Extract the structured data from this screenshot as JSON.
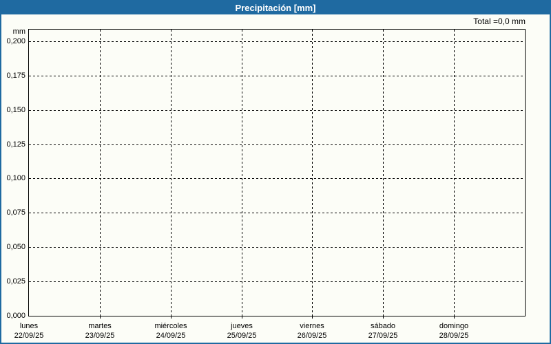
{
  "window": {
    "title": "Precipitación [mm]"
  },
  "colors": {
    "titlebar_bg": "#1f6aa1",
    "titlebar_text": "#ffffff",
    "frame_border": "#1f6aa1",
    "background": "#fcfdf7",
    "grid": "#000000",
    "text": "#000000"
  },
  "chart_data": {
    "type": "bar",
    "title": "Precipitación [mm]",
    "total_label": "Total =0,0 mm",
    "xlabel": "",
    "ylabel": "mm",
    "ylim": [
      0,
      0.2085
    ],
    "grid": true,
    "legend": false,
    "yticks": [
      {
        "value": 0.2,
        "label": "0,200"
      },
      {
        "value": 0.175,
        "label": "0,175"
      },
      {
        "value": 0.15,
        "label": "0,150"
      },
      {
        "value": 0.125,
        "label": "0,125"
      },
      {
        "value": 0.1,
        "label": "0,100"
      },
      {
        "value": 0.075,
        "label": "0,075"
      },
      {
        "value": 0.05,
        "label": "0,050"
      },
      {
        "value": 0.025,
        "label": "0,025"
      },
      {
        "value": 0.0,
        "label": "0,000"
      }
    ],
    "categories": [
      {
        "day": "lunes",
        "date": "22/09/25"
      },
      {
        "day": "martes",
        "date": "23/09/25"
      },
      {
        "day": "miércoles",
        "date": "24/09/25"
      },
      {
        "day": "jueves",
        "date": "25/09/25"
      },
      {
        "day": "viernes",
        "date": "26/09/25"
      },
      {
        "day": "sábado",
        "date": "27/09/25"
      },
      {
        "day": "domingo",
        "date": "28/09/25"
      }
    ],
    "series": [
      {
        "name": "Precipitación",
        "values": [
          0,
          0,
          0,
          0,
          0,
          0,
          0
        ]
      }
    ]
  }
}
